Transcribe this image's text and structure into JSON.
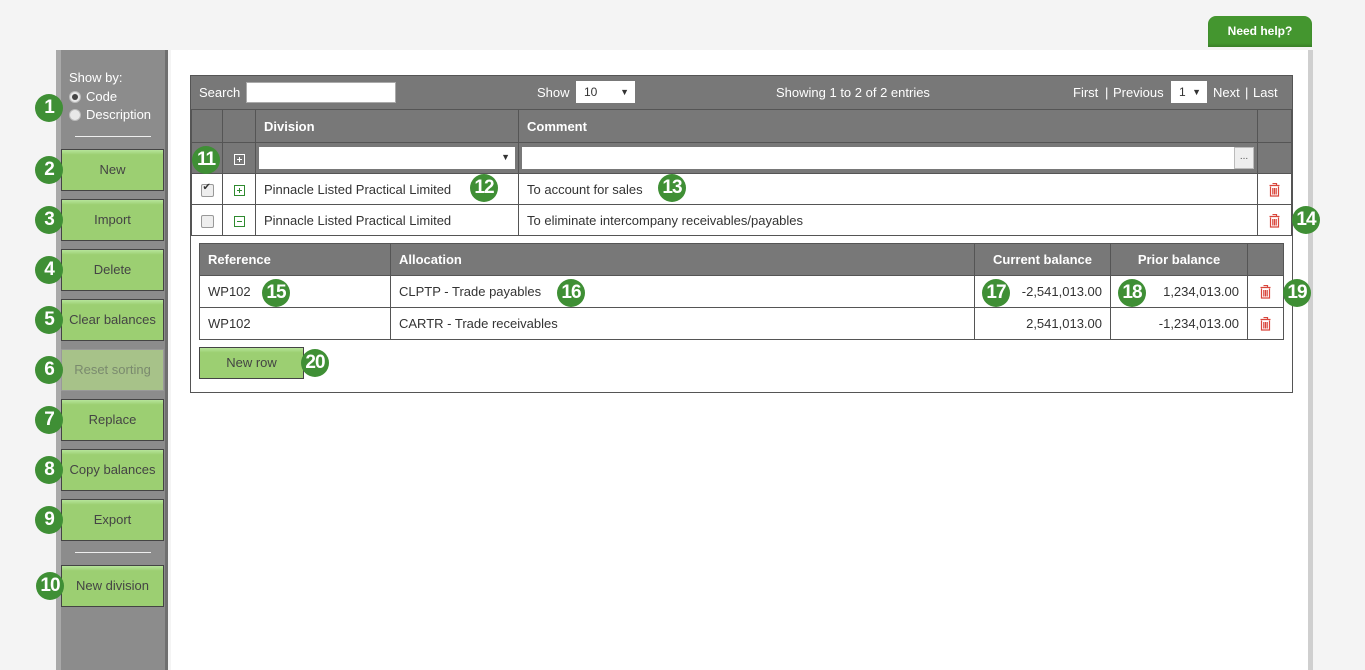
{
  "help": {
    "label": "Need help?"
  },
  "sidebar": {
    "show_by_label": "Show by:",
    "options": [
      {
        "label": "Code",
        "selected": true
      },
      {
        "label": "Description",
        "selected": false
      }
    ],
    "buttons": [
      {
        "label": "New",
        "disabled": false
      },
      {
        "label": "Import",
        "disabled": false
      },
      {
        "label": "Delete",
        "disabled": false
      },
      {
        "label": "Clear balances",
        "disabled": false
      },
      {
        "label": "Reset sorting",
        "disabled": true
      },
      {
        "label": "Replace",
        "disabled": false
      },
      {
        "label": "Copy balances",
        "disabled": false
      },
      {
        "label": "Export",
        "disabled": false
      }
    ],
    "new_division": "New division"
  },
  "toolbar": {
    "search_label": "Search",
    "search_value": "",
    "show_label": "Show",
    "show_value": "10",
    "info": "Showing 1 to 2 of 2 entries",
    "first": "First",
    "sep": "|",
    "previous": "Previous",
    "page": "1",
    "next": "Next",
    "last": "Last"
  },
  "table": {
    "columns": [
      "Division",
      "Comment"
    ],
    "filter": {
      "division": "",
      "comment": "",
      "ellipsis": "..."
    },
    "rows": [
      {
        "checked": true,
        "expanded": false,
        "division": "Pinnacle Listed Practical Limited",
        "comment": "To account for sales"
      },
      {
        "checked": false,
        "expanded": true,
        "division": "Pinnacle Listed Practical Limited",
        "comment": "To eliminate intercompany receivables/payables"
      }
    ]
  },
  "detail": {
    "columns": [
      "Reference",
      "Allocation",
      "Current balance",
      "Prior balance"
    ],
    "rows": [
      {
        "reference": "WP102",
        "allocation": "CLPTP - Trade payables",
        "current": "-2,541,013.00",
        "prior": "1,234,013.00"
      },
      {
        "reference": "WP102",
        "allocation": "CARTR - Trade receivables",
        "current": "2,541,013.00",
        "prior": "-1,234,013.00"
      }
    ],
    "new_row": "New row"
  },
  "badges": [
    "1",
    "2",
    "3",
    "4",
    "5",
    "6",
    "7",
    "8",
    "9",
    "10",
    "11",
    "12",
    "13",
    "14",
    "15",
    "16",
    "17",
    "18",
    "19",
    "20"
  ],
  "colors": {
    "accent": "#44962f",
    "button": "#9ccf72",
    "header": "#787878",
    "delete": "#d9453b"
  }
}
